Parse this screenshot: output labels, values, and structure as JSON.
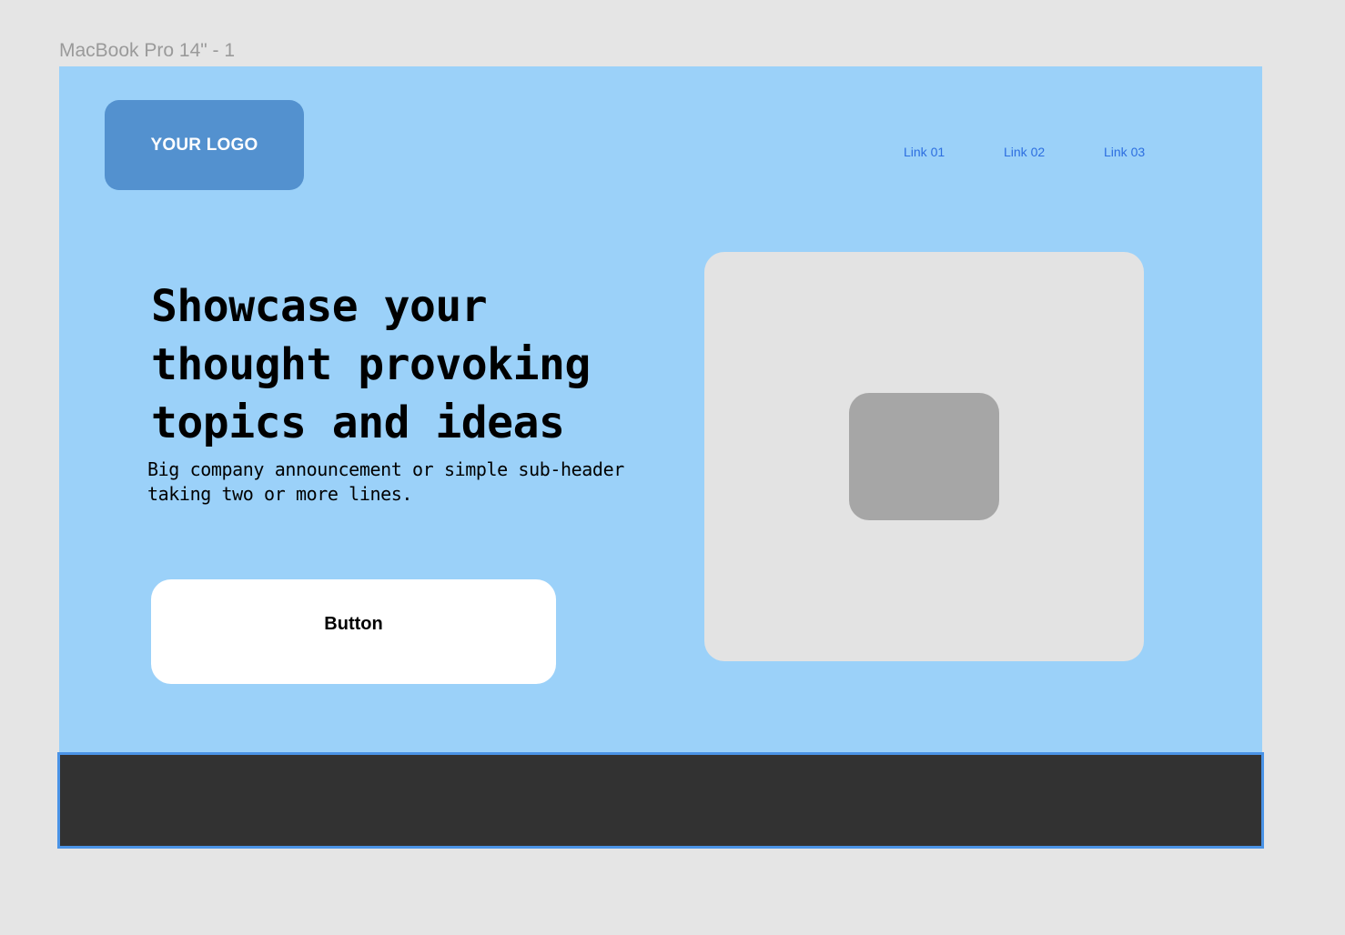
{
  "frame": {
    "title": "MacBook Pro 14\" - 1"
  },
  "header": {
    "logo_text": "YOUR LOGO",
    "nav": [
      {
        "label": "Link 01"
      },
      {
        "label": "Link 02"
      },
      {
        "label": "Link 03"
      }
    ]
  },
  "hero": {
    "headline": "Showcase your thought provoking topics and ideas",
    "subheader": "Big company announcement or simple sub-header taking two or more lines.",
    "button_label": "Button"
  },
  "colors": {
    "canvas": "#e5e5e5",
    "frame_background": "#9bd1f9",
    "logo_background": "#5391cf",
    "link": "#2d6fe0",
    "media_placeholder": "#e3e3e3",
    "media_inner_placeholder": "#a6a6a6",
    "footer": "#323232",
    "selection_outline": "#4a93e6"
  }
}
